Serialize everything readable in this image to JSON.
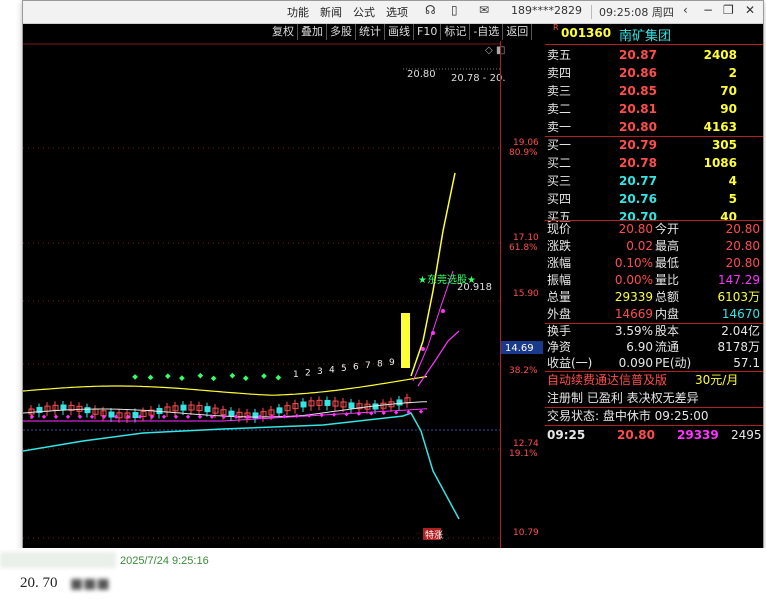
{
  "titlebar": {
    "menus": [
      "功能",
      "新闻",
      "公式",
      "选项"
    ],
    "account": "189****2829",
    "clock": "09:25:08 周四",
    "icons": [
      "chat-icon",
      "disk-icon",
      "mail-icon"
    ]
  },
  "toolbar": [
    "复权",
    "叠加",
    "多股",
    "统计",
    "画线",
    "F10",
    "标记",
    "-自选",
    "返回"
  ],
  "stock": {
    "badge": "R",
    "code": "001360",
    "name": "南矿集团"
  },
  "order_book": {
    "sells": [
      {
        "label": "卖五",
        "price": "20.87",
        "vol": "2408"
      },
      {
        "label": "卖四",
        "price": "20.86",
        "vol": "2"
      },
      {
        "label": "卖三",
        "price": "20.85",
        "vol": "70"
      },
      {
        "label": "卖二",
        "price": "20.81",
        "vol": "90"
      },
      {
        "label": "卖一",
        "price": "20.80",
        "vol": "4163"
      }
    ],
    "buys": [
      {
        "label": "买一",
        "price": "20.79",
        "vol": "305"
      },
      {
        "label": "买二",
        "price": "20.78",
        "vol": "1086"
      },
      {
        "label": "买三",
        "price": "20.77",
        "vol": "4"
      },
      {
        "label": "买四",
        "price": "20.76",
        "vol": "5"
      },
      {
        "label": "买五",
        "price": "20.70",
        "vol": "40"
      }
    ]
  },
  "stats": [
    {
      "l1": "现价",
      "v1": "20.80",
      "l2": "今开",
      "v2": "20.80"
    },
    {
      "l1": "涨跌",
      "v1": "0.02",
      "l2": "最高",
      "v2": "20.80"
    },
    {
      "l1": "涨幅",
      "v1": "0.10%",
      "l2": "最低",
      "v2": "20.80"
    },
    {
      "l1": "振幅",
      "v1": "0.00%",
      "l2": "量比",
      "v2": "147.29"
    },
    {
      "l1": "总量",
      "v1": "29339",
      "l2": "总额",
      "v2": "6103万"
    },
    {
      "l1": "外盘",
      "v1": "14669",
      "l2": "内盘",
      "v2": "14670"
    }
  ],
  "stats2": [
    {
      "l1": "换手",
      "v1": "3.59%",
      "l2": "股本",
      "v2": "2.04亿"
    },
    {
      "l1": "净资",
      "v1": "6.90",
      "l2": "流通",
      "v2": "8178万"
    },
    {
      "l1": "收益(一)",
      "v1": "0.090",
      "l2": "PE(动)",
      "v2": "57.1"
    }
  ],
  "ad": {
    "line1": "自动续费通达信普及版",
    "price": "30元/月",
    "line2": "注册制 已盈利 表决权无差异"
  },
  "trade_status": "交易状态: 盘中休市 09:25:00",
  "tick": {
    "time": "09:25",
    "price": "20.80",
    "vol": "29339",
    "num": "2495"
  },
  "chart_labels": {
    "top_price": "20.80",
    "top_range": "20.78 - 20.",
    "peak_label": "20.918",
    "annotation": "★东莞选股★",
    "cur_price": "14.69",
    "signal": "特涨",
    "wave_nums": [
      "1",
      "2",
      "3",
      "4",
      "5",
      "6",
      "7",
      "8",
      "9"
    ],
    "yaxis": [
      {
        "v": "19.06",
        "p": "80.9%"
      },
      {
        "v": "17.10",
        "p": "61.8%"
      },
      {
        "v": "15.90",
        "p": ""
      },
      {
        "v": "",
        "p": "38.2%"
      },
      {
        "v": "12.74",
        "p": "19.1%"
      },
      {
        "v": "10.79",
        "p": ""
      }
    ]
  },
  "colors": {
    "up": "#ff4d4d",
    "down": "#33e5e5",
    "ma1": "#ffff33",
    "ma2": "#ff33ff",
    "ma3": "#e6e6e6"
  },
  "footer": {
    "date": "2025/7/24 9:25:16",
    "text": "20. 70"
  }
}
